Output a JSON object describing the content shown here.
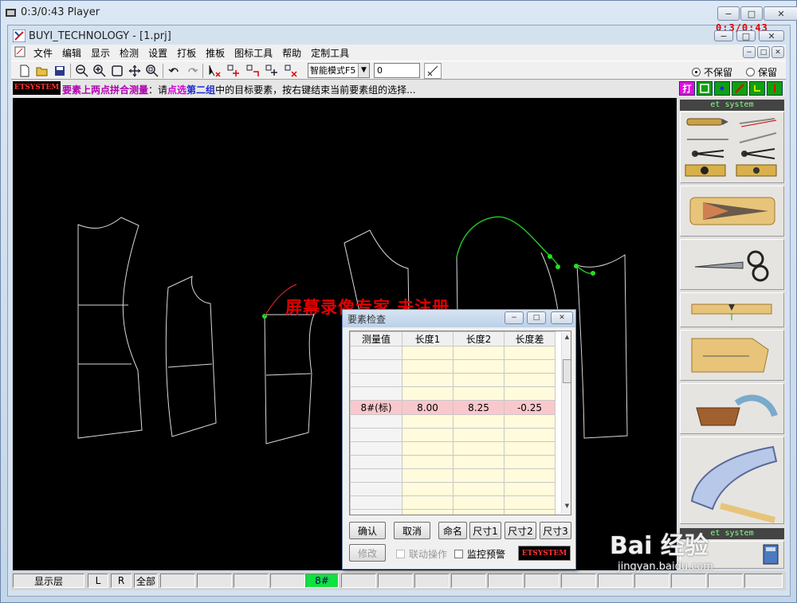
{
  "player": {
    "title": "0:3/0:43 Player",
    "timer": "0:3/0:43",
    "min_btn": "−",
    "max_btn": "□",
    "close_btn": "✕"
  },
  "app": {
    "title": "BUYI_TECHNOLOGY - [1.prj]",
    "menu": [
      "文件",
      "编辑",
      "显示",
      "检测",
      "设置",
      "打板",
      "推板",
      "图标工具",
      "帮助",
      "定制工具"
    ],
    "mode_select": "智能模式F5",
    "value_input": "0",
    "radio_options": [
      {
        "label": "不保留",
        "checked": true
      },
      {
        "label": "保留",
        "checked": false
      }
    ],
    "logo_text": "ETSYSTEM",
    "mode_button_label": "打"
  },
  "prompt": {
    "part1": "要素上两点拼合测量",
    "part2": "：请",
    "part3": "点选",
    "part4": "第二组",
    "part5": "中的目标要素，按右键结束当前要素组的选择..."
  },
  "canvas": {
    "watermark": "屏幕录像专家  未注册"
  },
  "tool_panel": {
    "header_top": "et system",
    "header_bottom": "et system"
  },
  "bottombar": {
    "layer": "显示层",
    "l": "L",
    "r": "R",
    "all": "全部",
    "size": "8#"
  },
  "dialog": {
    "title": "要素检查",
    "columns": [
      "测量值",
      "长度1",
      "长度2",
      "长度差"
    ],
    "rows": [
      [
        "",
        "",
        "",
        ""
      ],
      [
        "",
        "",
        "",
        ""
      ],
      [
        "",
        "",
        "",
        ""
      ],
      [
        "",
        "",
        "",
        ""
      ],
      [
        "8#(标)",
        "8.00",
        "8.25",
        "-0.25"
      ],
      [
        "",
        "",
        "",
        ""
      ],
      [
        "",
        "",
        "",
        ""
      ],
      [
        "",
        "",
        "",
        ""
      ],
      [
        "",
        "",
        "",
        ""
      ],
      [
        "",
        "",
        "",
        ""
      ],
      [
        "",
        "",
        "",
        ""
      ],
      [
        "",
        "",
        "",
        ""
      ],
      [
        "",
        "",
        "",
        ""
      ]
    ],
    "highlight_row": 4,
    "buttons": {
      "confirm": "确认",
      "cancel": "取消",
      "rename": "命名",
      "size1": "尺寸1",
      "size2": "尺寸2",
      "size3": "尺寸3",
      "modify": "修改"
    },
    "checks": {
      "linked": "联动操作",
      "monitor": "监控预警"
    },
    "logo": "ETSYSTEM"
  },
  "baidu": {
    "brand": "Bai 经验",
    "url": "jingyan.baidu.com"
  },
  "colors": {
    "canvas_bg": "#000000",
    "pattern_line": "#d8d8e0",
    "selected_curve": "#22c022",
    "highlight_row": "#f9c8cc",
    "watermark": "#e00000"
  }
}
